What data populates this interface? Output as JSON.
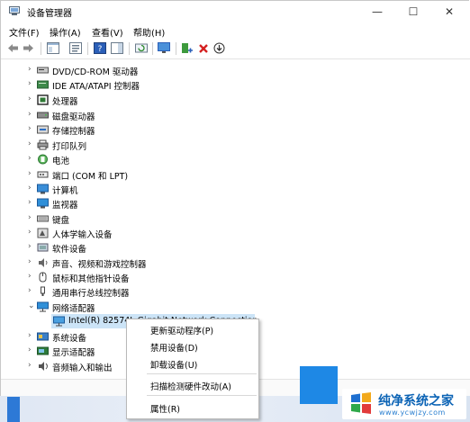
{
  "window": {
    "title": "设备管理器",
    "minimize_glyph": "—",
    "maximize_glyph": "☐",
    "close_glyph": "✕"
  },
  "menu": [
    "文件(F)",
    "操作(A)",
    "查看(V)",
    "帮助(H)"
  ],
  "tree": {
    "categories": [
      {
        "label": "DVD/CD-ROM 驱动器",
        "icon": "dvd-drive-icon",
        "expanded": false
      },
      {
        "label": "IDE ATA/ATAPI 控制器",
        "icon": "ide-controller-icon",
        "expanded": false
      },
      {
        "label": "处理器",
        "icon": "processor-icon",
        "expanded": false
      },
      {
        "label": "磁盘驱动器",
        "icon": "disk-drive-icon",
        "expanded": false
      },
      {
        "label": "存储控制器",
        "icon": "storage-controller-icon",
        "expanded": false
      },
      {
        "label": "打印队列",
        "icon": "printer-icon",
        "expanded": false
      },
      {
        "label": "电池",
        "icon": "battery-icon",
        "expanded": false
      },
      {
        "label": "端口 (COM 和 LPT)",
        "icon": "port-icon",
        "expanded": false
      },
      {
        "label": "计算机",
        "icon": "computer-icon",
        "expanded": false
      },
      {
        "label": "监视器",
        "icon": "monitor-icon",
        "expanded": false
      },
      {
        "label": "键盘",
        "icon": "keyboard-icon",
        "expanded": false
      },
      {
        "label": "人体学输入设备",
        "icon": "hid-icon",
        "expanded": false
      },
      {
        "label": "软件设备",
        "icon": "software-device-icon",
        "expanded": false
      },
      {
        "label": "声音、视频和游戏控制器",
        "icon": "sound-icon",
        "expanded": false
      },
      {
        "label": "鼠标和其他指针设备",
        "icon": "mouse-icon",
        "expanded": false
      },
      {
        "label": "通用串行总线控制器",
        "icon": "usb-icon",
        "expanded": false
      },
      {
        "label": "网络适配器",
        "icon": "network-adapter-icon",
        "expanded": true
      },
      {
        "label": "Intel(R) 82574L Gigabit Network Connection",
        "icon": "network-card-icon",
        "child": true,
        "selected": true
      },
      {
        "label": "系统设备",
        "icon": "system-device-icon",
        "expanded": false
      },
      {
        "label": "显示适配器",
        "icon": "display-adapter-icon",
        "expanded": false
      },
      {
        "label": "音频输入和输出",
        "icon": "audio-io-icon",
        "expanded": false
      }
    ]
  },
  "context_menu": {
    "items": [
      "更新驱动程序(P)",
      "禁用设备(D)",
      "卸载设备(U)",
      "扫描检测硬件改动(A)",
      "属性(R)"
    ]
  },
  "watermark": {
    "title": "纯净系统之家",
    "url": "www.ycwjzy.com"
  },
  "colors": {
    "accent": "#0078d4",
    "selection": "#cce4f7",
    "watermark_blue": "#0b63b5"
  }
}
